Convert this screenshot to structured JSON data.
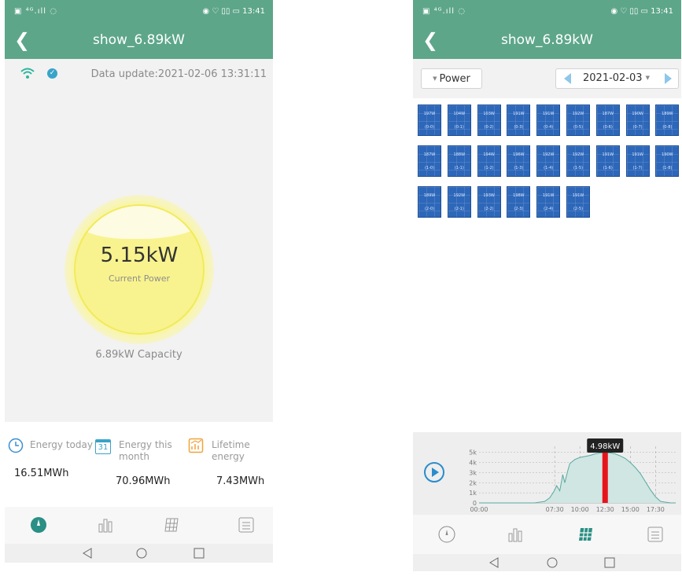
{
  "status_bar": {
    "left": "▣ ⁴ᴳ.ıll ◌",
    "right": "◉ ♡ ▯▯ ▭ 13:41"
  },
  "screen_a": {
    "title": "show_6.89kW",
    "data_update": "Data update:2021-02-06 13:31:11",
    "current_power": "5.15kW",
    "current_power_label": "Current Power",
    "capacity": "6.89kW Capacity",
    "energy": {
      "today_label": "Energy today",
      "today_value": "16.51MWh",
      "month_label_1": "Energy this",
      "month_label_2": "month",
      "month_icon_text": "31",
      "month_value": "70.96MWh",
      "lifetime_label_1": "Lifetime",
      "lifetime_label_2": "energy",
      "lifetime_value": "7.43MWh"
    },
    "gauge_fill_fraction": 0.75
  },
  "screen_b": {
    "title": "show_6.89kW",
    "selector_label": "Power",
    "date": "2021-02-03",
    "panels": [
      {
        "power": "197W",
        "id": "(0-0)"
      },
      {
        "power": "104W",
        "id": "(0-1)"
      },
      {
        "power": "103W",
        "id": "(0-2)"
      },
      {
        "power": "191W",
        "id": "(0-3)"
      },
      {
        "power": "191W",
        "id": "(0-4)"
      },
      {
        "power": "192W",
        "id": "(0-5)"
      },
      {
        "power": "187W",
        "id": "(0-6)"
      },
      {
        "power": "190W",
        "id": "(0-7)"
      },
      {
        "power": "189W",
        "id": "(0-8)"
      },
      {
        "power": "187W",
        "id": "(1-0)"
      },
      {
        "power": "188W",
        "id": "(1-1)"
      },
      {
        "power": "194W",
        "id": "(1-2)"
      },
      {
        "power": "196W",
        "id": "(1-3)"
      },
      {
        "power": "192W",
        "id": "(1-4)"
      },
      {
        "power": "192W",
        "id": "(1-5)"
      },
      {
        "power": "191W",
        "id": "(1-6)"
      },
      {
        "power": "191W",
        "id": "(1-7)"
      },
      {
        "power": "190W",
        "id": "(1-8)"
      },
      {
        "power": "189W",
        "id": "(2-0)"
      },
      {
        "power": "192W",
        "id": "(2-1)"
      },
      {
        "power": "193W",
        "id": "(2-2)"
      },
      {
        "power": "198W",
        "id": "(2-3)"
      },
      {
        "power": "191W",
        "id": "(2-4)"
      },
      {
        "power": "191W",
        "id": "(2-5)"
      }
    ],
    "chart_data": {
      "type": "area",
      "x_tick_labels": [
        "00:00",
        "07:30",
        "10:00",
        "12:30",
        "15:00",
        "17:30"
      ],
      "y_tick_labels": [
        "0",
        "1k",
        "2k",
        "3k",
        "4k",
        "5k"
      ],
      "ylim": [
        0,
        5600
      ],
      "xlim_hours": [
        0,
        19.5
      ],
      "x": [
        0,
        5.5,
        6.5,
        7.0,
        7.4,
        7.7,
        8.0,
        8.3,
        8.5,
        8.8,
        9.0,
        9.5,
        10.0,
        10.5,
        11.0,
        11.5,
        12.0,
        12.5,
        13.0,
        13.5,
        14.0,
        14.5,
        15.0,
        15.5,
        16.0,
        16.5,
        17.0,
        17.5,
        18.0,
        19.0,
        19.5
      ],
      "y": [
        0,
        0,
        150,
        500,
        1100,
        1700,
        1200,
        2800,
        2000,
        3200,
        3900,
        4300,
        4500,
        4600,
        4700,
        4850,
        4950,
        4980,
        4950,
        4850,
        4650,
        4400,
        4000,
        3500,
        2900,
        2100,
        1300,
        600,
        150,
        0,
        0
      ],
      "marker_time": "12:30",
      "marker_hours": 12.5,
      "tooltip": "4.98kW",
      "fill_color": "#cfe6e3",
      "line_color": "#5aa8a0",
      "marker_color": "#e8141c"
    }
  },
  "colors": {
    "header": "#5da68a",
    "accent_blue": "#2b8ccc"
  }
}
